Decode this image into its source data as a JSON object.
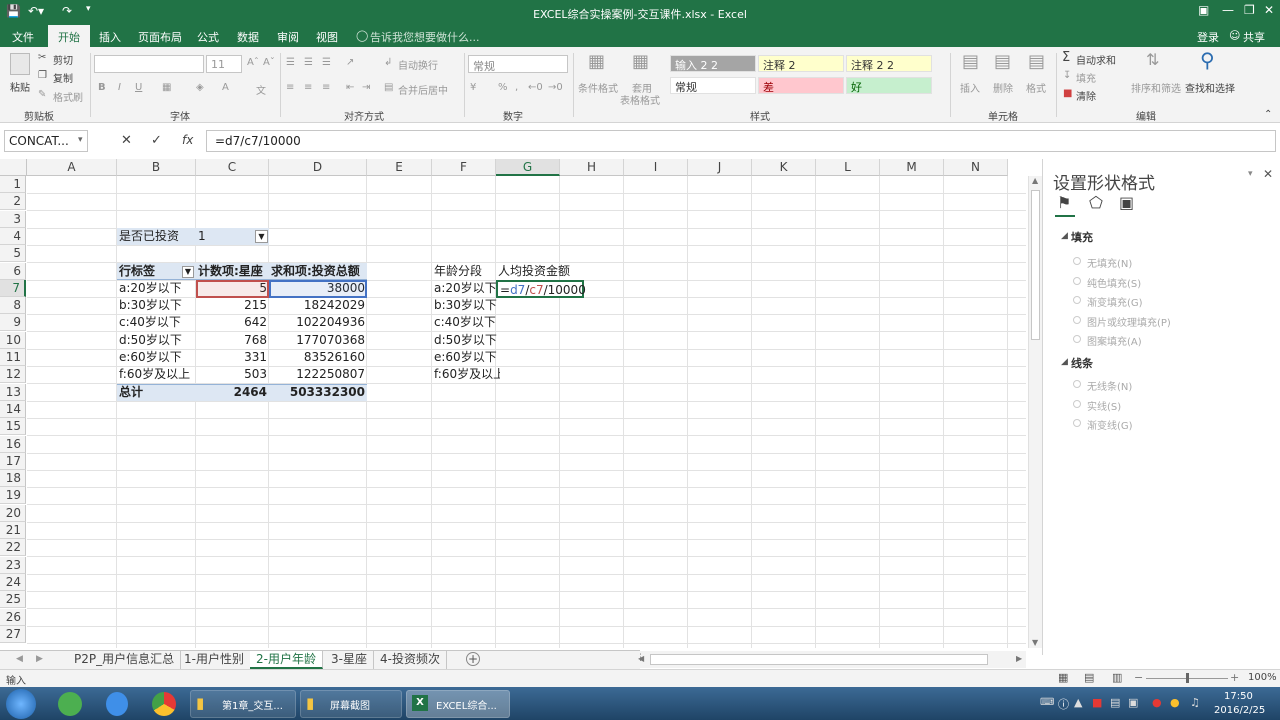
{
  "window": {
    "title": "EXCEL综合实操案例-交互课件.xlsx - Excel"
  },
  "ribbon": {
    "tabs": [
      "文件",
      "开始",
      "插入",
      "页面布局",
      "公式",
      "数据",
      "审阅",
      "视图"
    ],
    "tell_me": "告诉我您想要做什么...",
    "login": "登录",
    "share": "共享",
    "clipboard": {
      "paste": "粘贴",
      "cut": "剪切",
      "copy": "复制",
      "format_painter": "格式刷",
      "group": "剪贴板"
    },
    "font": {
      "size": "11",
      "group": "字体"
    },
    "alignment": {
      "wrap": "自动换行",
      "merge": "合并后居中",
      "group": "对齐方式"
    },
    "number": {
      "format": "常规",
      "group": "数字"
    },
    "styles": {
      "conditional": "条件格式",
      "table_format_1": "套用",
      "table_format_2": "表格格式",
      "s1": "输入 2 2",
      "s2": "注释 2",
      "s3": "注释 2 2",
      "s4": "常规",
      "s5": "差",
      "s6": "好",
      "group": "样式"
    },
    "cells": {
      "insert": "插入",
      "delete": "删除",
      "format": "格式",
      "group": "单元格"
    },
    "editing": {
      "autosum": "自动求和",
      "fill": "填充",
      "clear": "清除",
      "sort": "排序和筛选",
      "find": "查找和选择",
      "group": "编辑"
    }
  },
  "formula_bar": {
    "name_box": "CONCAT...",
    "formula": "=d7/c7/10000"
  },
  "sheet": {
    "columns": [
      "A",
      "B",
      "C",
      "D",
      "E",
      "F",
      "G",
      "H",
      "I",
      "J",
      "K",
      "L",
      "M",
      "N"
    ],
    "rows": [
      "1",
      "2",
      "3",
      "4",
      "5",
      "6",
      "7",
      "8",
      "9",
      "10",
      "11",
      "12",
      "13",
      "14",
      "15",
      "16",
      "17",
      "18",
      "19",
      "20",
      "21",
      "22",
      "23",
      "24",
      "25",
      "26",
      "27"
    ],
    "pivot": {
      "filter_label": "是否已投资",
      "filter_value": "1",
      "headers": [
        "行标签",
        "计数项:星座",
        "求和项:投资总额"
      ],
      "rows": [
        {
          "label": "a:20岁以下",
          "count": "5",
          "sum": "38000"
        },
        {
          "label": "b:30岁以下",
          "count": "215",
          "sum": "18242029"
        },
        {
          "label": "c:40岁以下",
          "count": "642",
          "sum": "102204936"
        },
        {
          "label": "d:50岁以下",
          "count": "768",
          "sum": "177070368"
        },
        {
          "label": "e:60岁以下",
          "count": "331",
          "sum": "83526160"
        },
        {
          "label": "f:60岁及以上",
          "count": "503",
          "sum": "122250807"
        }
      ],
      "total": {
        "label": "总计",
        "count": "2464",
        "sum": "503332300"
      }
    },
    "summary": {
      "headers": [
        "年龄分段",
        "人均投资金额"
      ],
      "rows": [
        "a:20岁以下",
        "b:30岁以下",
        "c:40岁以下",
        "d:50岁以下",
        "e:60岁以下",
        "f:60岁及以上"
      ],
      "edit": {
        "eq": "=",
        "ref_d": "d7",
        "sep1": "/",
        "ref_c": "c7",
        "rest": "/10000"
      }
    }
  },
  "taskpane": {
    "title": "设置形状格式",
    "fill_section": "填充",
    "fill_options": [
      "无填充(N)",
      "纯色填充(S)",
      "渐变填充(G)",
      "图片或纹理填充(P)",
      "图案填充(A)"
    ],
    "line_section": "线条",
    "line_options": [
      "无线条(N)",
      "实线(S)",
      "渐变线(G)"
    ]
  },
  "sheet_tabs": [
    "P2P_用户信息汇总",
    "1-用户性别",
    "2-用户年龄",
    "3-星座",
    "4-投资频次"
  ],
  "status": {
    "mode": "输入",
    "zoom": "100%"
  },
  "taskbar": {
    "items": [
      "第1章_交互...",
      "屏幕截图",
      "EXCEL综合..."
    ],
    "time": "17:50",
    "date": "2016/2/25"
  },
  "colors": {
    "excel_green": "#217346",
    "ref_blue": "#4472c4",
    "ref_red": "#c0504d",
    "pivot_header": "#dde7f3"
  }
}
